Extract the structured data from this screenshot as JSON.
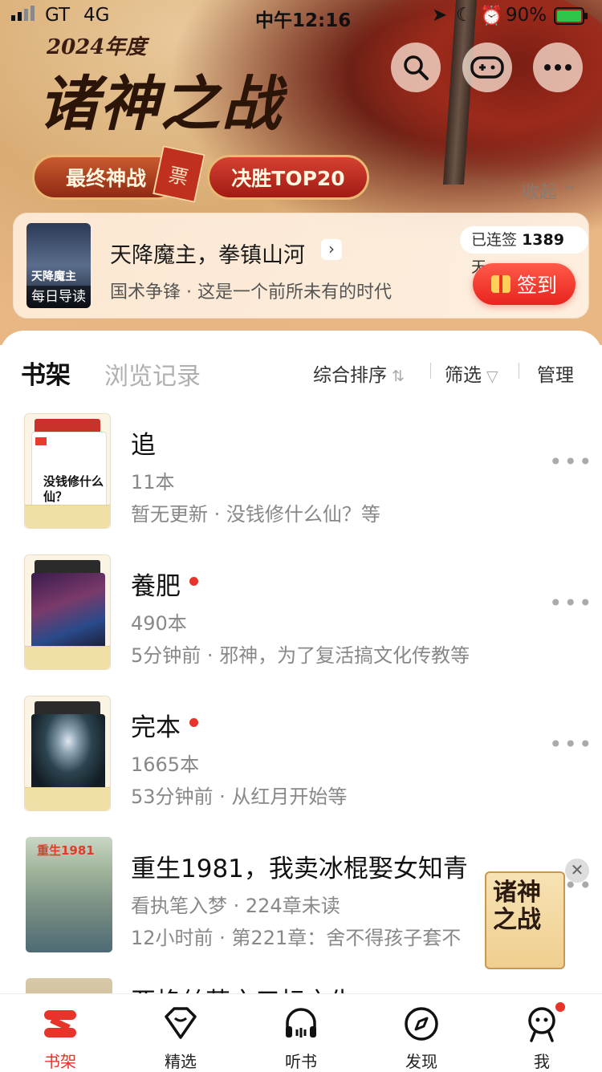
{
  "status_bar": {
    "carrier": "GT",
    "network": "4G",
    "time": "中午12:16",
    "battery": "90%"
  },
  "banner": {
    "year": "2024年度",
    "title": "诸神之战",
    "ribbon_left": "最终神战",
    "seal": "票",
    "ribbon_right": "决胜TOP20",
    "collapse": "收起"
  },
  "header_actions": [
    "search-icon",
    "gamepad-icon",
    "more-icon"
  ],
  "daily": {
    "cover_title": "天降魔主",
    "cover_tag": "每日导读",
    "title": "天降魔主，拳镇山河",
    "subtitle": "国术争锋 · 这是一个前所未有的时代",
    "streak_prefix": "已连签",
    "streak_days": "1389",
    "streak_suffix": "天",
    "sign_label": "签到"
  },
  "shelf_tabs": {
    "active": "书架",
    "inactive": "浏览记录"
  },
  "tools": {
    "sort": "综合排序",
    "filter": "筛选",
    "manage": "管理"
  },
  "rows": [
    {
      "title": "追",
      "line1": "11本",
      "line2": "暂无更新 · 没钱修什么仙？等",
      "dot": false,
      "cover_text": "没钱修什么仙？"
    },
    {
      "title": "養肥",
      "line1": "490本",
      "line2": "5分钟前 · 邪神，为了复活搞文化传教等",
      "dot": true
    },
    {
      "title": "完本",
      "line1": "1665本",
      "line2": "53分钟前 · 从红月开始等",
      "dot": true
    },
    {
      "title": "重生1981，我卖冰棍娶女知青",
      "line1": "看执笔入梦 · 224章未读",
      "line2": "12小时前 · 第221章：舍不得孩子套不",
      "dot": false,
      "cover_text": "重生1981"
    },
    {
      "title": "亚格丝茄之三标之生"
    }
  ],
  "float_ad": {
    "text": "诸神之战"
  },
  "tabbar": [
    {
      "label": "书架",
      "active": true
    },
    {
      "label": "精选",
      "active": false
    },
    {
      "label": "听书",
      "active": false
    },
    {
      "label": "发现",
      "active": false
    },
    {
      "label": "我",
      "active": false,
      "badge": true
    }
  ]
}
